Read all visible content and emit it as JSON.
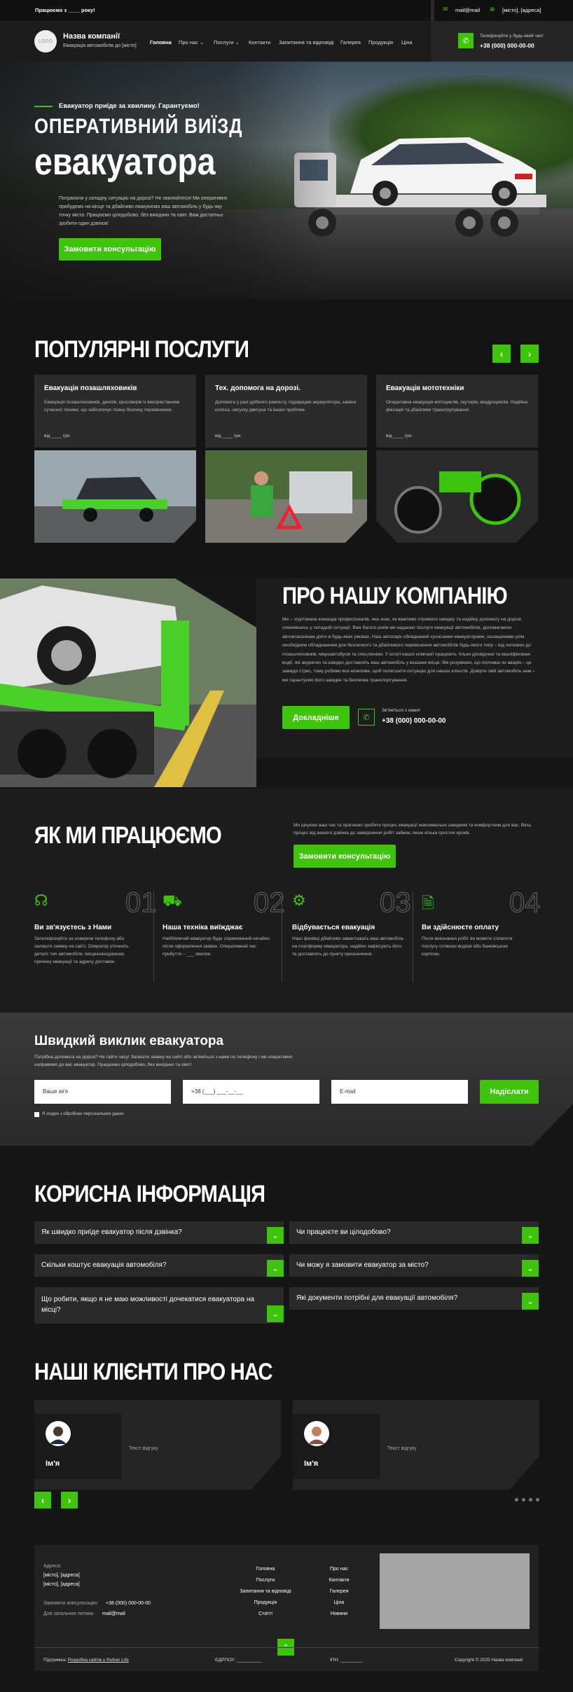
{
  "topbar": {
    "schedule": "Працюємо з ____ року!",
    "email": "mail@mail",
    "address": "[місто], [адреса]"
  },
  "header": {
    "logo": "LOGO",
    "company": "Назва компанії",
    "tagline": "Евакуація автомобілів до [місто]",
    "nav": [
      "Головна",
      "Про нас",
      "Послуги",
      "Контакти",
      "Запитання та відповіді",
      "Галерея",
      "Продукція",
      "Ціна"
    ],
    "call_caption": "Телефонуйте у будь-який час!",
    "phone": "+38 (000) 000-00-00"
  },
  "hero": {
    "kicker": "Евакуатор приїде за хвилину. Гарантуємо!",
    "title1": "ОПЕРАТИВНИЙ ВИЇЗД",
    "title2": "евакуатора",
    "text": "Потрапили у складну ситуацію на дорозі? Не хвилюйтеся! Ми оперативно прибудемо на місце та дбайливо евакуюємо ваш автомобіль у будь-яку точку міста. Працюємо цілодобово, без вихідних та свят. Вам достатньо зробити один дзвінок!",
    "cta": "Замовити консультацію"
  },
  "services": {
    "title": "ПОПУЛЯРНІ ПОСЛУГИ",
    "items": [
      {
        "name": "Евакуація позашляховиків",
        "text": "Евакуація позашляховиків, джипів, кросоверів із використанням сучасної техніки, що забезпечує повну безпеку перевезення.",
        "price": "від ____ грн."
      },
      {
        "name": "Тех. допомога на дорозі.",
        "text": "Допомога у разі дрібного ремонту, підзарядки акумулятора, заміни колеса, запуску двигуна та інших проблем.",
        "price": "від ____ грн."
      },
      {
        "name": "Евакуація мототехніки",
        "text": "Оперативна евакуація мотоциклів, скутерів, квадроциклів. Надійна фіксація та дбайливе транспортування.",
        "price": "від ____ грн."
      }
    ]
  },
  "about": {
    "title": "ПРО НАШУ КОМПАНІЮ",
    "text": "Ми – згуртована команда професіоналів, яка знає, як важливо отримати швидку та надійну допомогу на дорозі, опинившись у складній ситуації. Вже багато років ми надаємо послуги евакуації автомобілів, допомагаючи автовласникам діяти в будь-яких умовах. Наш автопарк обладнаний сучасними евакуаторами, оснащеними усім необхідним обладнанням для безпечного та дбайливого перевезення автомобілів будь-якого типу – від легкових до позашляховиків, мікроавтобусів та спецтехніки. У штаті нашої компанії працюють тільки досвідчені та кваліфіковані водії, які акуратно та швидко доставлять ваш автомобіль у вказане місце. Ми розуміємо, що поломка чи аварія – це завжди стрес, тому робимо все можливе, щоб полегшити ситуацію для наших клієнтів. Довірте свій автомобіль нам – ми гарантуємо його швидке та безпечне транспортування.",
    "cta": "Докладніше",
    "call_caption": "Зв'яжіться з нами!",
    "phone": "+38 (000) 000-00-00"
  },
  "how": {
    "title": "ЯК МИ ПРАЦЮЄМО",
    "text": "Ми цінуємо ваш час та прагнемо зробити процес евакуації максимально швидким та комфортним для вас. Весь процес від вашого дзвінка до завершення робіт займає лише кілька простих кроків.",
    "cta": "Замовити консультацію",
    "steps": [
      {
        "num": "01",
        "title": "Ви зв'язуєтесь з Нами",
        "text": "Зателефонуйте за номером телефону або залиште заявку на сайті. Оператор уточнить деталі: тип автомобіля, місцезнаходження, причину евакуації та адресу доставки."
      },
      {
        "num": "02",
        "title": "Наша техніка виїжджає",
        "text": "Найближчий евакуатор буде спрямований негайно після оформлення заявки. Оперативний час прибуття – ___ хвилин."
      },
      {
        "num": "03",
        "title": "Відбувається евакуація",
        "text": "Наші фахівці дбайливо завантажать ваш автомобіль на платформу евакуатора, надійно зафіксують його та доставлять до пункту призначення."
      },
      {
        "num": "04",
        "title": "Ви здійснюєте оплату",
        "text": "Після виконання робіт ви можете сплатити послугу готівкою водієві або банківською карткою."
      }
    ]
  },
  "quick": {
    "title": "Швидкий виклик евакуатора",
    "text": "Потрібна допомога на дорозі? Не гайте часу! Залиште заявку на сайті або зв'яжіться з нами по телефону і ми оперативно направимо до вас евакуатор. Працюємо цілодобово, без вихідних та свят!",
    "name_ph": "Ваше ім'я",
    "phone_ph": "+38 (___) ___-__-__",
    "email_ph": "E-mail",
    "submit": "Надіслати",
    "consent": "Я згоден з обробкою персональних даних"
  },
  "faq": {
    "title": "КОРИСНА ІНФОРМАЦІЯ",
    "items": [
      "Як швидко приїде евакуатор після дзвінка?",
      "Чи працюєте ви цілодобово?",
      "Скільки коштує евакуація автомобіля?",
      "Чи можу я замовити евакуатор за місто?",
      "Що робити, якщо я не маю можливості дочекатися евакуатора на місці?",
      "Які документи потрібні для евакуації автомобіля?"
    ]
  },
  "reviews": {
    "title": "НАШІ КЛІЄНТИ ПРО НАС",
    "items": [
      {
        "name": "Ім'я",
        "text": "Текст відгуку"
      },
      {
        "name": "Ім'я",
        "text": "Текст відгуку"
      }
    ]
  },
  "footer": {
    "addr_label": "Адреса:",
    "addr1": "[місто], [адреса]",
    "addr2": "[місто], [адреса]",
    "consult_label": "Замовити консультацію:",
    "consult_phone": "+38 (000) 000-00-00",
    "email_label": "Для загальних питань:",
    "email": "mail@mail",
    "links1": [
      "Головна",
      "Послуги",
      "Запитання та відповіді",
      "Продукція",
      "Статті"
    ],
    "links2": [
      "Про нас",
      "Контакти",
      "Галерея",
      "Ціна",
      "Новини"
    ],
    "support": "Підтримка",
    "made_by": "Розробка сайтів у Ruther Life",
    "edrpou": "ЄДРПОУ: __________",
    "ipn": "ІПН: _________",
    "copyright": "Copyright © 2025 Назва компанії"
  }
}
